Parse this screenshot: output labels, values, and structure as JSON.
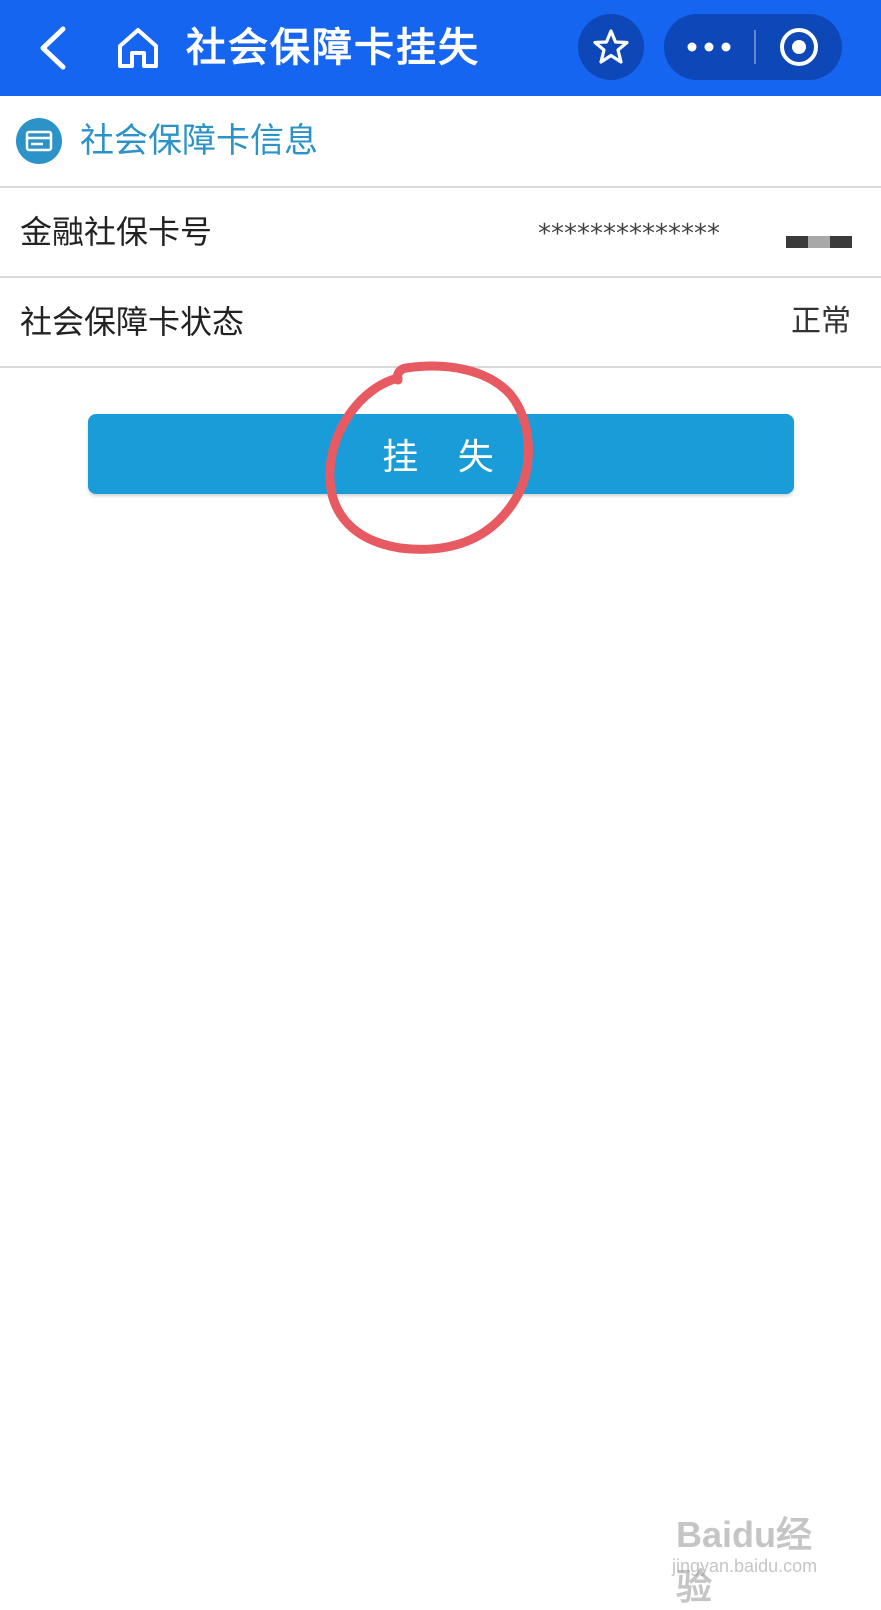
{
  "topbar": {
    "title": "社会保障卡挂失",
    "background_color": "#1565f0",
    "icons": [
      "back-chevron-icon",
      "home-icon",
      "star-icon",
      "more-dots-icon",
      "close-circle-icon"
    ]
  },
  "section": {
    "title": "社会保障卡信息",
    "icon": "card-icon",
    "accent_color": "#2b93c8"
  },
  "rows": [
    {
      "label": "金融社保卡号",
      "value": "**************"
    },
    {
      "label": "社会保障卡状态",
      "value": "正常"
    }
  ],
  "action": {
    "label": "挂 失",
    "button_color": "#1a9cd8"
  },
  "annotation": {
    "shape": "hand-drawn-circle",
    "color": "#e85a62"
  },
  "watermark": {
    "brand": "Baidu经验",
    "url": "jingyan.baidu.com"
  }
}
